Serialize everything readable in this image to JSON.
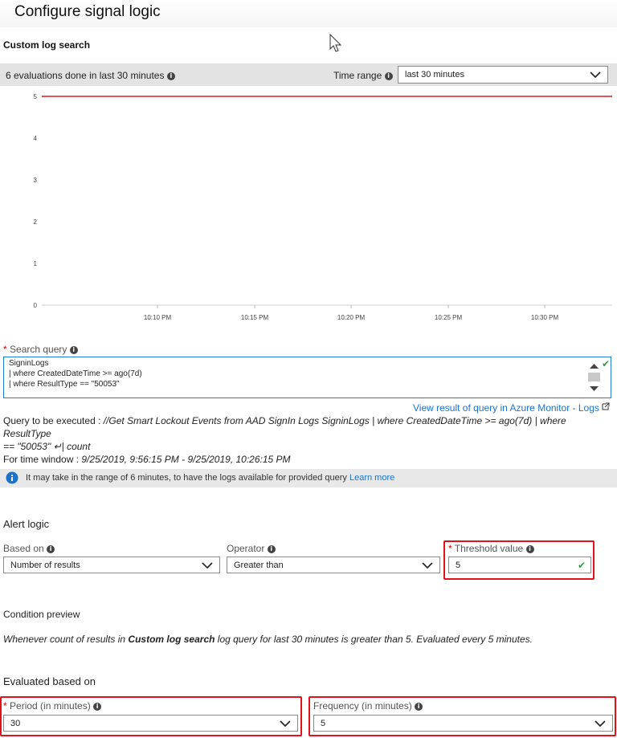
{
  "page": {
    "title": "Configure signal logic",
    "section_title": "Custom log search"
  },
  "evaluation": {
    "summary": "6 evaluations done  in last 30 minutes",
    "time_range_label": "Time range",
    "time_range_value": "last 30 minutes"
  },
  "chart_data": {
    "type": "line",
    "y_ticks": [
      "5",
      "4",
      "3",
      "2",
      "1",
      "0"
    ],
    "x_ticks": [
      "10:10 PM",
      "10:15 PM",
      "10:20 PM",
      "10:25 PM",
      "10:30 PM"
    ],
    "ylim": [
      0,
      5
    ],
    "series": [
      {
        "color": "#d81c23",
        "values": [
          5,
          5,
          5,
          5,
          5
        ]
      }
    ]
  },
  "search_query": {
    "label": "Search query",
    "lines": [
      "SigninLogs",
      "| where CreatedDateTime >= ago(7d)",
      "| where ResultType == \"50053\""
    ],
    "view_link": "View result of query in Azure Monitor - Logs",
    "exec_prefix": "Query to be executed : ",
    "exec_query_line1": "//Get Smart Lockout Events from AAD SignIn Logs SigninLogs | where CreatedDateTime >= ago(7d) | where ResultType",
    "exec_query_line2": "== \"50053\" ↵| count",
    "window_prefix": "For time window : ",
    "window_value": "9/25/2019, 9:56:15 PM - 9/25/2019, 10:26:15 PM"
  },
  "info_banner": {
    "text": "It may take in the range of 6 minutes, to have the logs available for provided query",
    "link": "Learn more"
  },
  "alert_logic": {
    "heading": "Alert logic",
    "based_on_label": "Based on",
    "based_on_value": "Number of results",
    "operator_label": "Operator",
    "operator_value": "Greater than",
    "threshold_label": "Threshold value",
    "threshold_value": "5"
  },
  "condition": {
    "heading": "Condition preview",
    "text_before": "Whenever count of results in ",
    "text_bold": "Custom log search",
    "text_after": " log query for last 30 minutes is greater than 5. Evaluated every 5 minutes."
  },
  "evaluated": {
    "heading": "Evaluated based on",
    "period_label": "Period (in minutes)",
    "period_value": "30",
    "frequency_label": "Frequency (in minutes)",
    "frequency_value": "5"
  },
  "icons": {
    "info": "i",
    "check": "✔",
    "required": "*"
  }
}
